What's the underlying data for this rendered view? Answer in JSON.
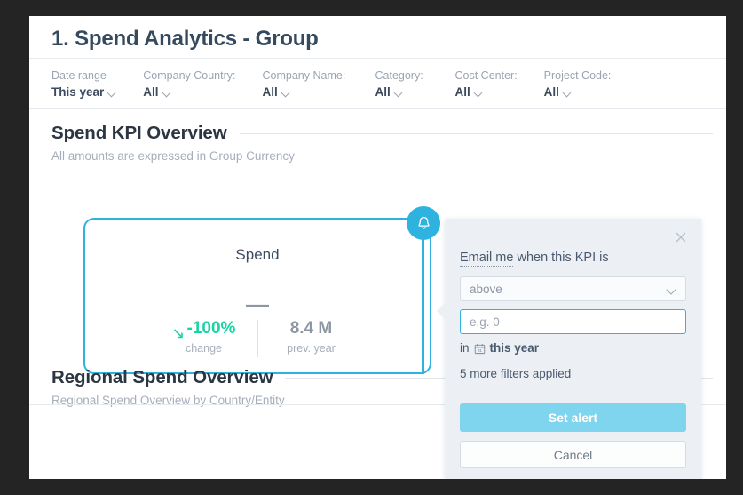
{
  "dashboard": {
    "title": "1. Spend Analytics - Group"
  },
  "filters": [
    {
      "label": "Date range",
      "value": "This year"
    },
    {
      "label": "Company Country:",
      "value": "All"
    },
    {
      "label": "Company Name:",
      "value": "All"
    },
    {
      "label": "Category:",
      "value": "All"
    },
    {
      "label": "Cost Center:",
      "value": "All"
    },
    {
      "label": "Project Code:",
      "value": "All"
    }
  ],
  "sections": {
    "kpi": {
      "title": "Spend KPI Overview",
      "subtitle": "All amounts are expressed in Group Currency"
    },
    "regional": {
      "title": "Regional Spend Overview",
      "subtitle": "Regional Spend Overview by Country/Entity"
    }
  },
  "kpi_card": {
    "name": "Spend",
    "value": "—",
    "change_value": "-100%",
    "change_label": "change",
    "prev_value": "8.4 M",
    "prev_label": "prev. year",
    "change_color": "#19d3a2",
    "border_color": "#2eb3e0",
    "trend_icon": "arrow-down-right-icon",
    "badge_icon": "bell-icon"
  },
  "alert_popover": {
    "close_icon": "close-icon",
    "label_prefix": "Email me",
    "label_rest": " when this KPI is",
    "condition_value": "above",
    "threshold_placeholder": "e.g. 0",
    "threshold_value": "",
    "period_prefix": "in",
    "period_icon": "calendar-icon",
    "period_value": "this year",
    "filters_note": "5 more filters applied",
    "primary_label": "Set alert",
    "secondary_label": "Cancel",
    "primary_color": "#7fd4ee"
  }
}
